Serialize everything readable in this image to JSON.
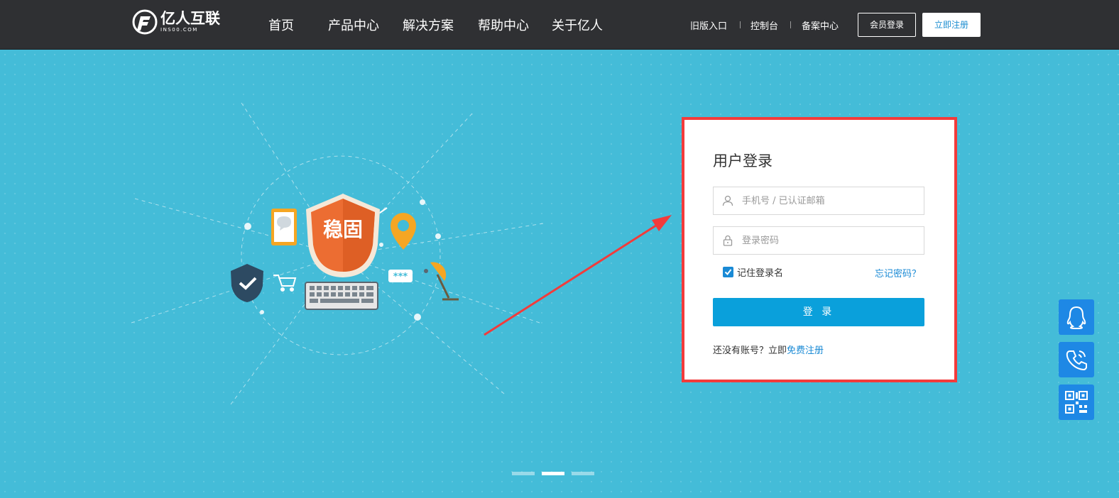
{
  "header": {
    "logo": {
      "cn": "亿人互联",
      "en": "INS00.COM"
    },
    "nav": [
      "首页",
      "产品中心",
      "解决方案",
      "帮助中心",
      "关于亿人"
    ],
    "links": [
      "旧版入口",
      "控制台",
      "备案中心"
    ],
    "login_button": "会员登录",
    "register_button": "立即注册"
  },
  "illustration": {
    "shield_text": "稳固",
    "password_bubble": "***"
  },
  "login": {
    "title": "用户登录",
    "username_placeholder": "手机号 / 已认证邮箱",
    "password_placeholder": "登录密码",
    "remember_label": "记住登录名",
    "remember_checked": true,
    "forgot_link": "忘记密码？",
    "submit_button": "登 录",
    "no_account_text": "还没有账号？立即",
    "register_link": "免费注册"
  },
  "floating_tools": [
    "qq-icon",
    "phone-icon",
    "qrcode-icon"
  ],
  "carousel": {
    "slides": 3,
    "active": 2
  },
  "colors": {
    "header_bg": "#2f3033",
    "hero_bg": "#44bcd8",
    "accent": "#0aa0db",
    "link": "#1a8ad5",
    "highlight_border": "#f23b3b",
    "shield": "#ec6d32",
    "float_button": "#1e88e5"
  }
}
